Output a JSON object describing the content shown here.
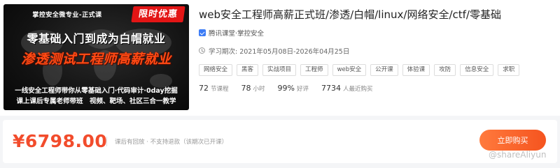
{
  "course": {
    "title": "web安全工程师高薪正式班/渗透/白帽/linux/网络安全/ctf/零基础",
    "provider": "腾讯课堂·掌控安全",
    "period": "学习期次: 2021年05月08日-2026年04月25日",
    "tags": [
      "网络安全",
      "黑客",
      "实战项目",
      "工程师",
      "web安全",
      "公开课",
      "体验课",
      "攻防",
      "信息安全",
      "求职"
    ],
    "stats": [
      {
        "num": "72",
        "unit": "节课程"
      },
      {
        "num": "78",
        "unit": "小时"
      },
      {
        "num": "99%",
        "unit": "好评"
      },
      {
        "num": "7734",
        "unit": "人最近购买"
      }
    ]
  },
  "cover": {
    "top_line": "掌控安全微专业-正式课",
    "badge": "限时优惠",
    "line1": "零基础入门到成为白帽就业",
    "line2": "渗透测试工程师高薪就业",
    "line3": "一线安全工程师带你从零基础入门·代码审计·0day挖掘",
    "line4": "课上课后专属老师带班　视频、靶场、社区三合一教学"
  },
  "purchase": {
    "price": "¥6798.00",
    "notice": "课后有回放 · 不支持退款（该期次已开课）",
    "button_label": "立即购买",
    "accent_color": "#f24c2c"
  },
  "watermark": "@shareAliyun"
}
